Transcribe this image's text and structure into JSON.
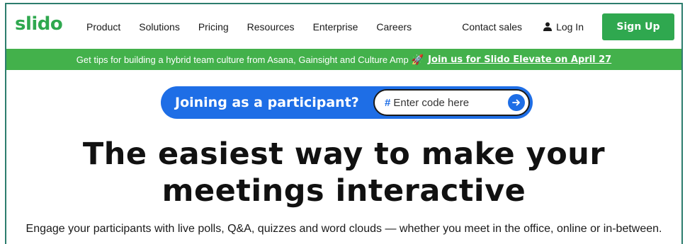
{
  "header": {
    "logo": "slido",
    "nav": [
      "Product",
      "Solutions",
      "Pricing",
      "Resources",
      "Enterprise",
      "Careers"
    ],
    "contact_sales": "Contact sales",
    "log_in": "Log In",
    "sign_up": "Sign Up"
  },
  "banner": {
    "text": "Get tips for building a hybrid team culture from Asana, Gainsight and Culture Amp",
    "icon": "rocket-icon",
    "link": "Join us for Slido Elevate on April 27"
  },
  "join": {
    "label": "Joining as a participant?",
    "hash": "#",
    "placeholder": "Enter code here"
  },
  "hero": {
    "line1": "The easiest way to make your",
    "line2": "meetings interactive",
    "subtitle": "Engage your participants with live polls, Q&A, quizzes and word clouds — whether you meet in the office, online or in-between."
  },
  "colors": {
    "brand_green": "#2fa84f",
    "banner_green": "#43b14b",
    "join_blue": "#1e6ee6"
  }
}
